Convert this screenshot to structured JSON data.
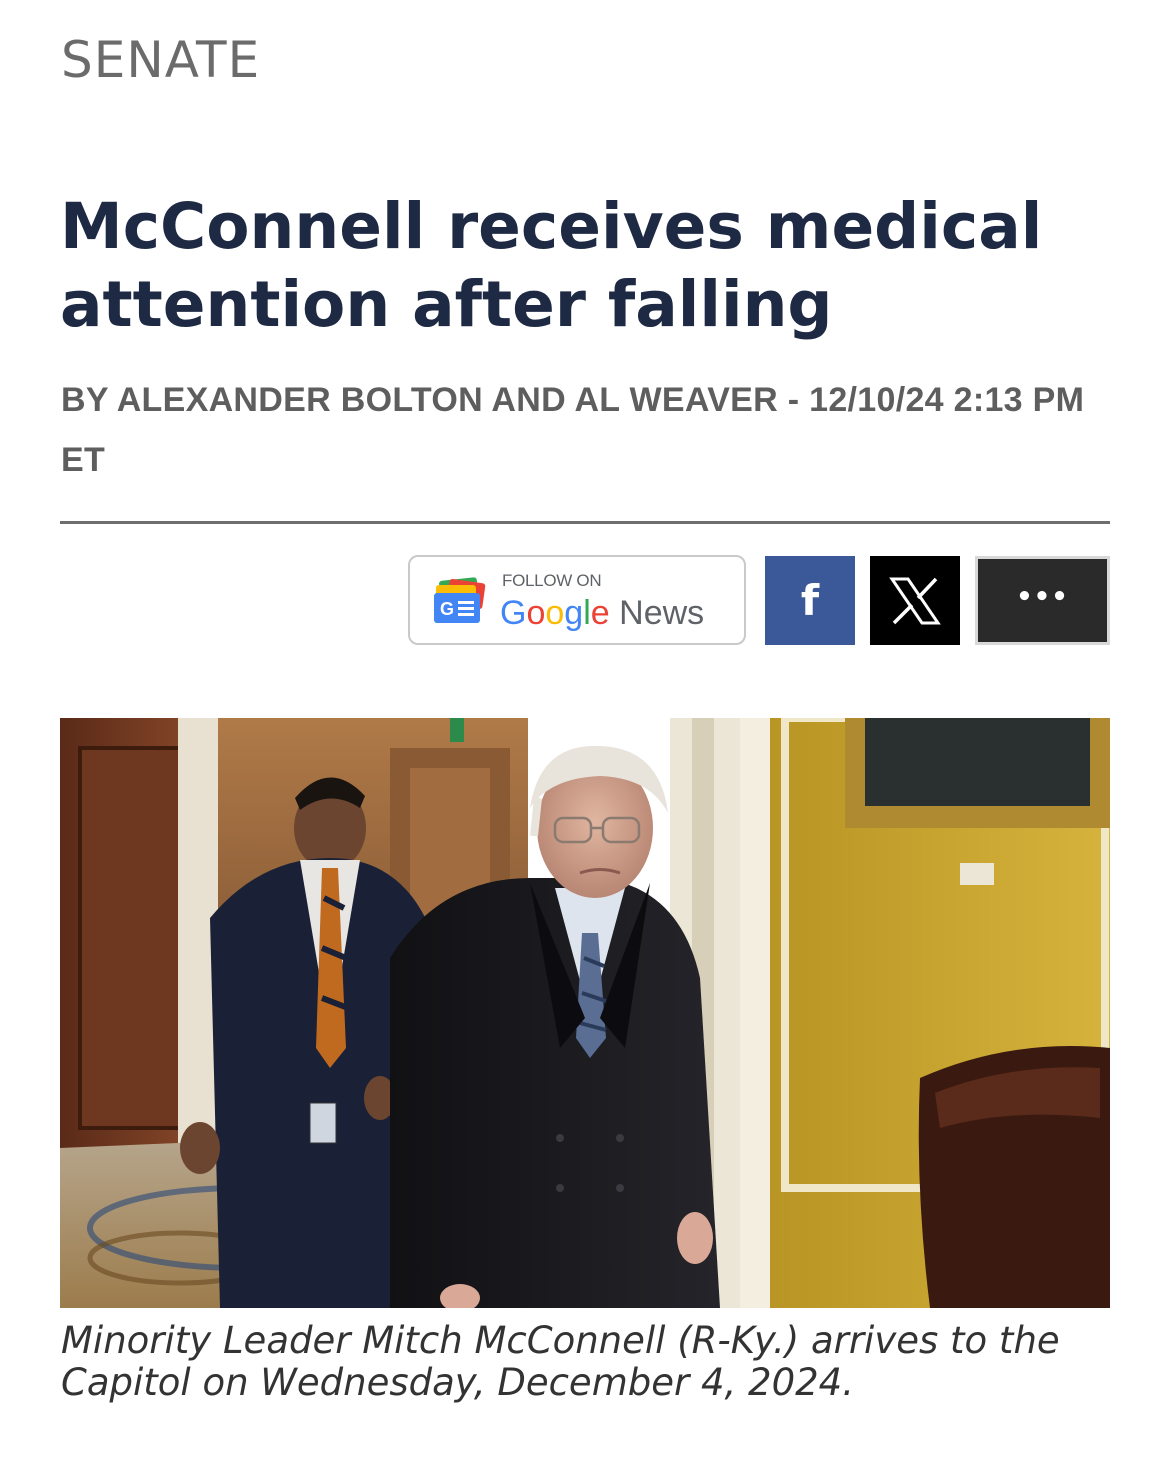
{
  "article": {
    "section": "SENATE",
    "headline": "McConnell receives medical attention after falling",
    "byline": "BY ALEXANDER BOLTON AND AL WEAVER - 12/10/24 2:13 PM ET",
    "caption": "Minority Leader Mitch McConnell (R-Ky.) arrives to the Capitol on Wednesday, December 4, 2024."
  },
  "share": {
    "google_news": {
      "follow_label": "FOLLOW ON",
      "google_letters": [
        "G",
        "o",
        "o",
        "g",
        "l",
        "e"
      ],
      "news_label": "News",
      "icon": "google-news-icon"
    },
    "facebook": {
      "glyph": "f",
      "icon": "facebook-icon"
    },
    "x": {
      "icon": "x-logo-icon"
    },
    "more": {
      "glyph": "•••",
      "icon": "more-icon"
    }
  },
  "colors": {
    "headline": "#1e2a44",
    "facebook": "#3b5998",
    "x": "#000000",
    "more": "#2a2a2a",
    "rule": "#6e6e6e"
  }
}
